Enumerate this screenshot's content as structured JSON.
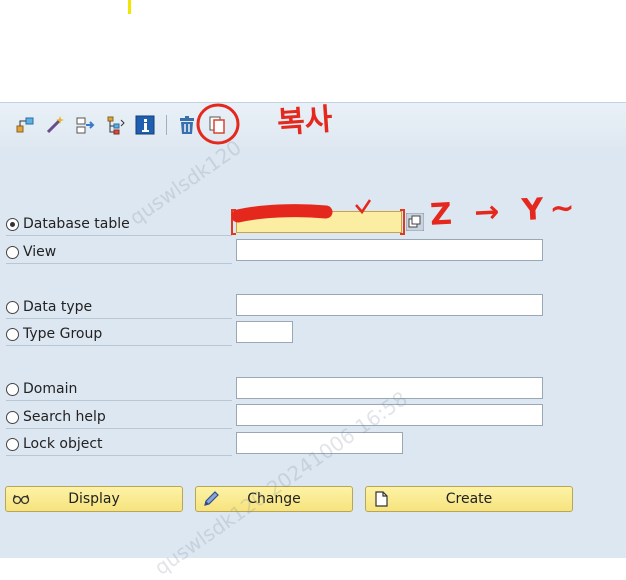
{
  "toolbar": {
    "icons": [
      "hierarchy-icon",
      "magic-wand-icon",
      "where-used-icon",
      "tree-icon",
      "info-icon",
      "delete-icon",
      "copy-icon"
    ]
  },
  "rows": [
    {
      "label": "Database table",
      "checked": true,
      "value": ""
    },
    {
      "label": "View",
      "checked": false,
      "value": ""
    },
    {
      "label": "Data type",
      "checked": false,
      "value": ""
    },
    {
      "label": "Type Group",
      "checked": false,
      "value": ""
    },
    {
      "label": "Domain",
      "checked": false,
      "value": ""
    },
    {
      "label": "Search help",
      "checked": false,
      "value": ""
    },
    {
      "label": "Lock object",
      "checked": false,
      "value": ""
    }
  ],
  "buttons": {
    "display": "Display",
    "change": "Change",
    "create": "Create"
  },
  "annotations": {
    "copy_note": "복사",
    "z_to_y": "Z → Y~"
  },
  "watermark": {
    "text1": "quswlsdk120",
    "text2": "quswlsdk120 20241006 16:58"
  },
  "colors": {
    "accent": "#e03a1e",
    "button_bg": "#f7e37e",
    "main_bg": "#dde7f1"
  }
}
